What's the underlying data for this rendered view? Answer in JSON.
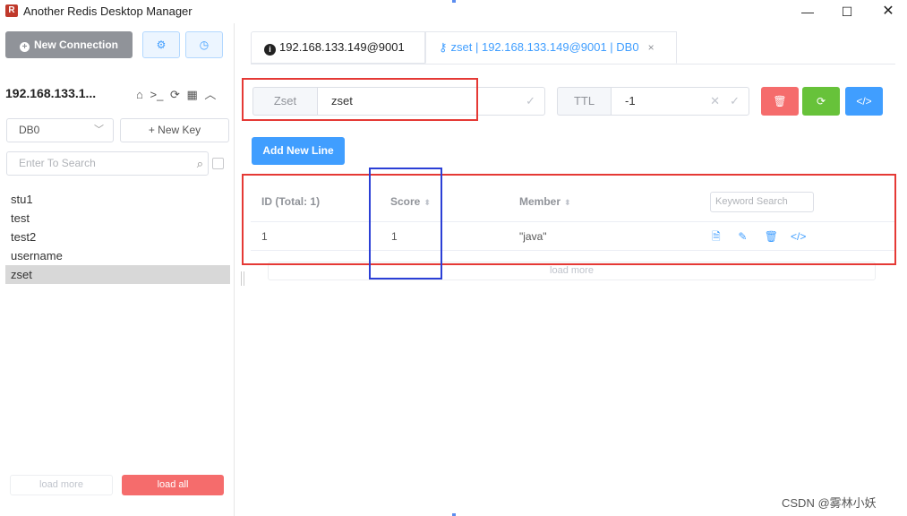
{
  "window": {
    "logo_glyph": "R",
    "title": "Another Redis Desktop Manager",
    "minimize_glyph": "—",
    "maximize_glyph": "☐",
    "close_glyph": "✕"
  },
  "sidebar": {
    "new_connection_label": "New Connection",
    "settings_icon_glyph": "⚙",
    "log_icon_glyph": "◷",
    "connection_name": "192.168.133.1...",
    "connection_icons": {
      "home": "⌂",
      "terminal": ">_",
      "refresh": "⟳",
      "grid": "▦",
      "collapse": "︿"
    },
    "db_select_value": "DB0",
    "new_key_label": "+ New Key",
    "search_placeholder": "Enter To Search",
    "keys": [
      "stu1",
      "test",
      "test2",
      "username",
      "zset"
    ],
    "active_key_index": 4,
    "load_more_label": "load more",
    "load_all_label": "load all"
  },
  "tabs": {
    "connection_tab": "192.168.133.149@9001",
    "key_tab": "zset | 192.168.133.149@9001 | DB0",
    "key_tab_close": "×"
  },
  "key_header": {
    "type_label": "Zset",
    "key_name": "zset",
    "ttl_label": "TTL",
    "ttl_value": "-1",
    "delete_icon": "🗑",
    "refresh_icon": "⟳",
    "dump_icon": "</>"
  },
  "add_new_line_label": "Add New Line",
  "table": {
    "headers": {
      "id": "ID (Total: 1)",
      "score": "Score",
      "member": "Member"
    },
    "keyword_search_placeholder": "Keyword Search",
    "rows": [
      {
        "id": "1",
        "score": "1",
        "member": "\"java\""
      }
    ],
    "row_op_icons": {
      "view": "🗎",
      "edit": "✎",
      "delete": "🗑",
      "code": "</>"
    },
    "load_more_label": "load more"
  },
  "watermark": "CSDN @雾林小妖",
  "colors": {
    "primary": "#409eff",
    "danger": "#f56c6c",
    "success": "#67c23a",
    "annotation_red": "#e53935",
    "annotation_blue": "#2b3fd6"
  }
}
